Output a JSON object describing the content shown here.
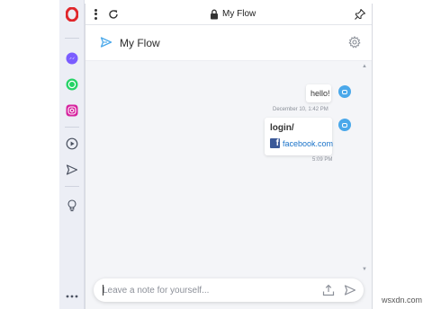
{
  "sidebar": {
    "items": [
      {
        "icon": "opera-logo-icon",
        "color": "#e0262b"
      },
      {
        "icon": "messenger-icon",
        "color": "#7a5cff"
      },
      {
        "icon": "whatsapp-icon",
        "color": "#25d366"
      },
      {
        "icon": "instagram-icon",
        "color": "#d6249f"
      },
      {
        "icon": "player-icon"
      },
      {
        "icon": "flow-send-icon"
      },
      {
        "icon": "lightbulb-icon"
      },
      {
        "icon": "more-dots-icon"
      }
    ]
  },
  "addressbar": {
    "title": "My Flow"
  },
  "header": {
    "title": "My Flow"
  },
  "messages": [
    {
      "text": "hello!",
      "time": "December 10, 1:42 PM"
    },
    {
      "title": "login/",
      "link_text": "facebook.com",
      "time": "5:09 PM"
    }
  ],
  "input": {
    "placeholder": "Leave a note for yourself..."
  },
  "watermark": "wsxdn.com",
  "colors": {
    "accent": "#4aa8ea",
    "link": "#1a73c9",
    "facebook": "#3b5998"
  }
}
